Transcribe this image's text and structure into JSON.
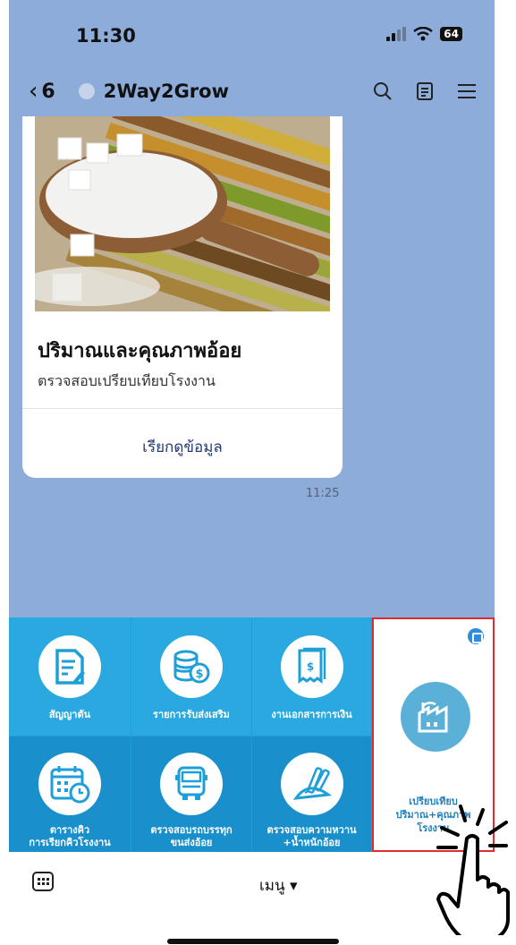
{
  "status": {
    "time": "11:30",
    "battery": "64"
  },
  "header": {
    "back_count": "6",
    "title": "2Way2Grow"
  },
  "message": {
    "title": "ปริมาณและคุณภาพอ้อย",
    "subtitle": "ตรวจสอบเปรียบเทียบโรงงาน",
    "action": "เรียกดูข้อมูล",
    "time": "11:25"
  },
  "richmenu": {
    "items": [
      {
        "label": "สัญญาตัน",
        "icon": "contract-icon"
      },
      {
        "label": "รายการรับส่งเสริม",
        "icon": "coins-icon"
      },
      {
        "label": "งานเอกสารการเงิน",
        "icon": "receipt-icon"
      },
      {
        "label_1": "ตารางคิว",
        "label_2": "การเรียกคิวโรงงาน",
        "icon": "calendar-icon"
      },
      {
        "label_1": "ตรวจสอบรถบรรทุก",
        "label_2": "ขนส่งอ้อย",
        "icon": "truck-icon"
      },
      {
        "label_1": "ตรวจสอบความหวาน",
        "label_2": "+น้ำหนักอ้อย",
        "icon": "sugarcane-icon"
      }
    ],
    "factory": {
      "label_1": "เปรียบเทียบ",
      "label_2": "ปริมาณ+คุณภาพ",
      "label_3": "โรงงาน",
      "icon": "factory-icon"
    }
  },
  "bottom": {
    "menu_label": "เมนู ▾"
  }
}
